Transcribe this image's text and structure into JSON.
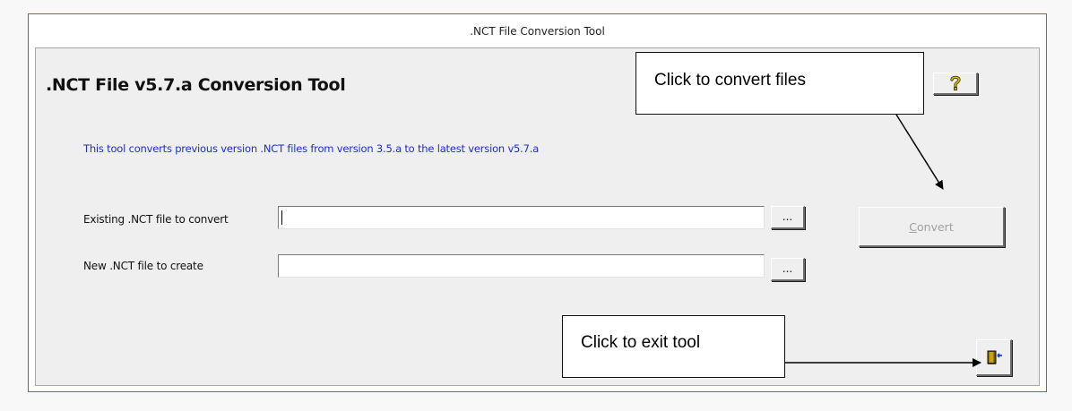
{
  "window": {
    "title": ".NCT File Conversion Tool"
  },
  "main": {
    "heading": ".NCT File v5.7.a Conversion Tool",
    "description": "This tool converts previous version .NCT files from version 3.5.a to the latest version v5.7.a",
    "existing_file": {
      "label": "Existing .NCT file to convert",
      "value": "",
      "browse_label": "..."
    },
    "new_file": {
      "label": "New .NCT file to create",
      "value": "",
      "browse_label": "..."
    },
    "convert_button": {
      "mnemonic": "C",
      "rest": "onvert",
      "enabled": false
    },
    "help_button": {
      "icon": "question-mark-icon"
    },
    "exit_button": {
      "icon": "exit-door-icon"
    }
  },
  "annotations": {
    "convert_callout": "Click to convert files",
    "exit_callout": "Click to exit tool"
  },
  "colors": {
    "window_border": "#c4464d",
    "description_text": "#1a2dd8",
    "disabled_text": "#a0a0a0",
    "help_icon": "#e8c000"
  }
}
